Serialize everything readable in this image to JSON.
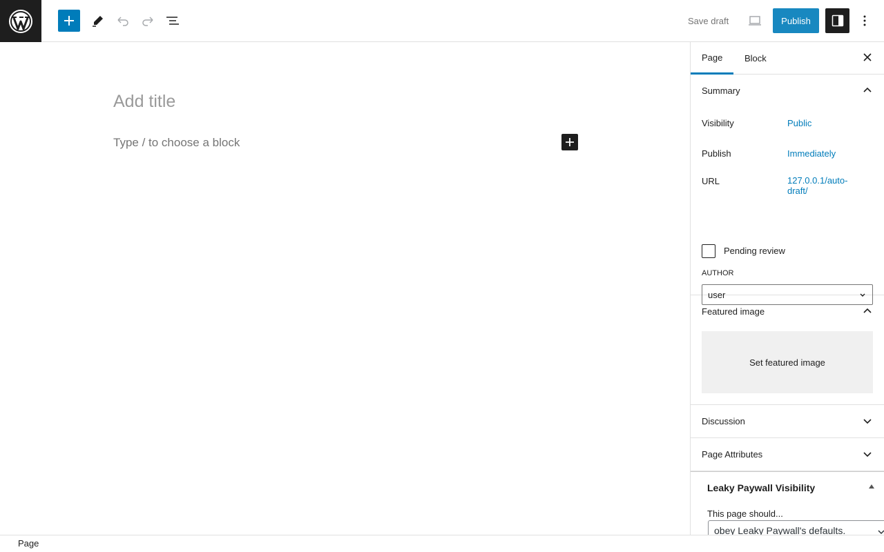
{
  "header": {
    "logo_icon": "wordpress-logo-icon",
    "save_draft_label": "Save draft",
    "publish_label": "Publish",
    "accent_color": "#007cba"
  },
  "editor": {
    "title_placeholder": "Add title",
    "block_placeholder": "Type / to choose a block"
  },
  "sidebar": {
    "tabs": [
      {
        "label": "Page",
        "active": true
      },
      {
        "label": "Block",
        "active": false
      }
    ],
    "summary": {
      "heading": "Summary",
      "rows": [
        {
          "label": "Visibility",
          "value": "Public"
        },
        {
          "label": "Publish",
          "value": "Immediately"
        },
        {
          "label": "URL",
          "value": "127.0.0.1/auto-draft/"
        }
      ],
      "pending_review_label": "Pending review",
      "pending_review_checked": false,
      "author_label": "AUTHOR",
      "author_value": "user"
    },
    "featured_image": {
      "heading": "Featured image",
      "button_label": "Set featured image"
    },
    "discussion_heading": "Discussion",
    "page_attributes_heading": "Page Attributes",
    "leaky_paywall": {
      "heading": "Leaky Paywall Visibility",
      "label": "This page should...",
      "select_value": "obey Leaky Paywall's defaults."
    }
  },
  "footer": {
    "breadcrumb": "Page"
  }
}
